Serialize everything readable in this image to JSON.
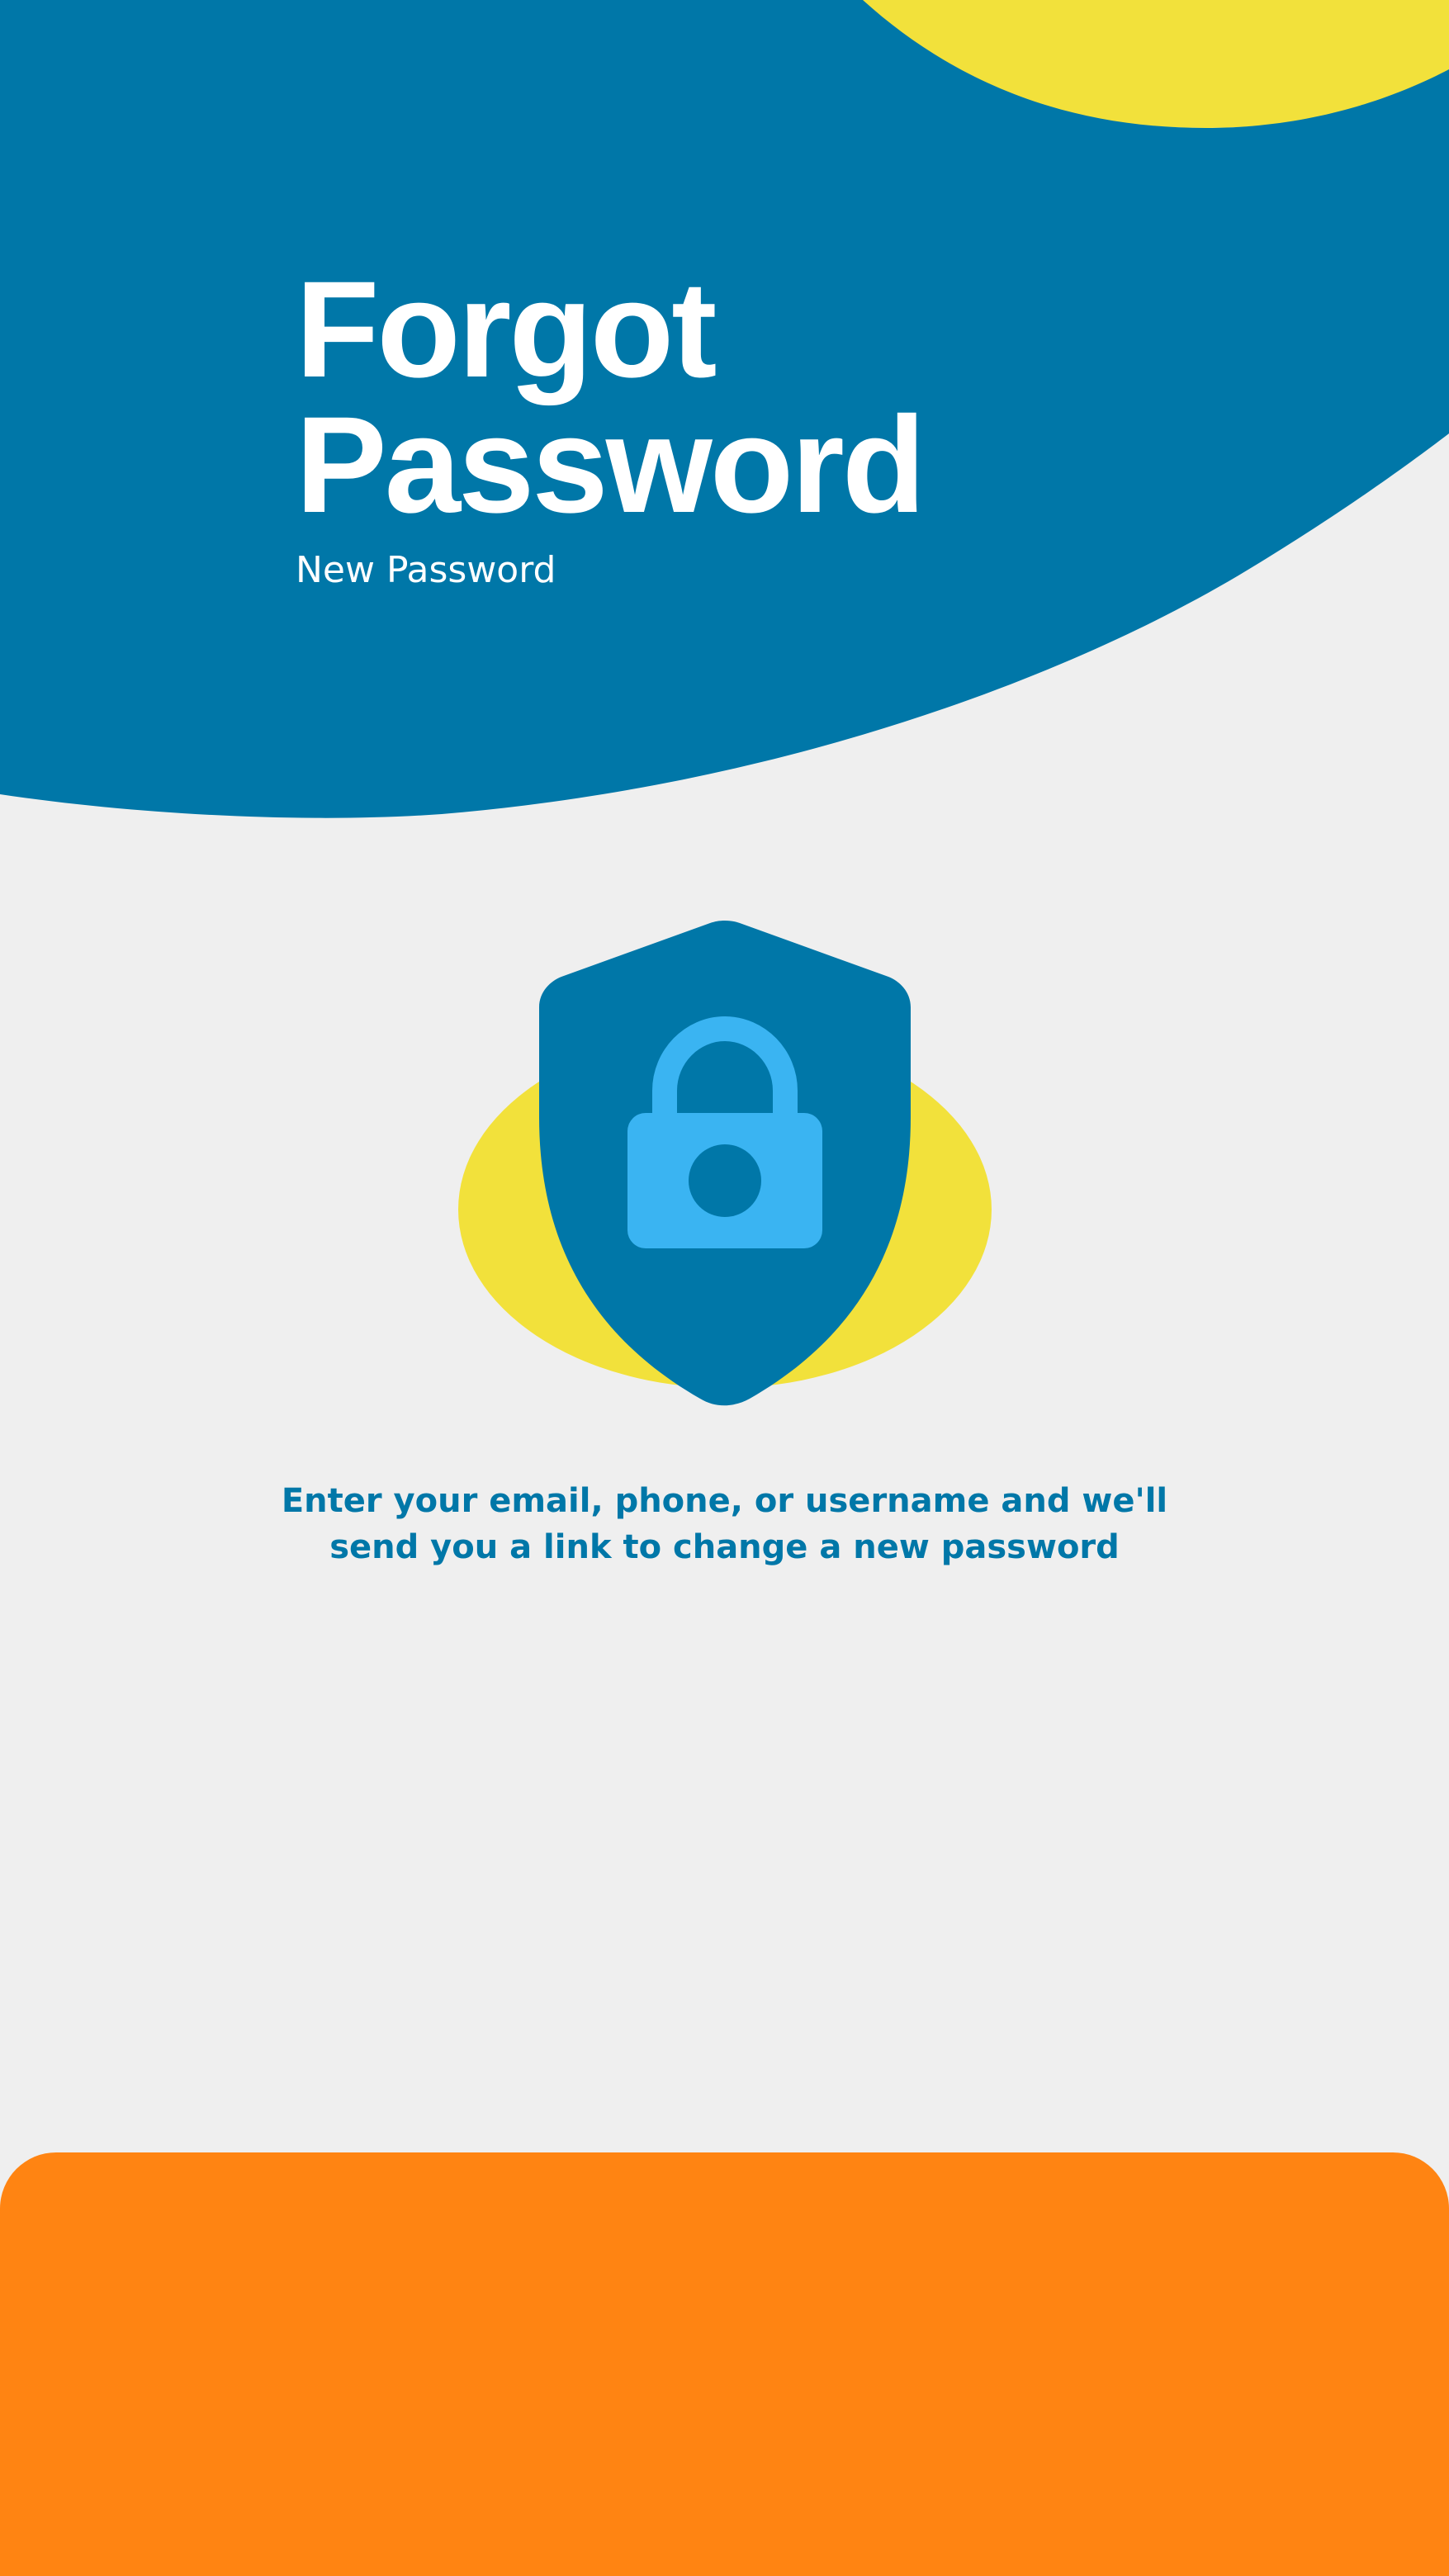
{
  "header": {
    "title_line1": "Forgot",
    "title_line2": "Password",
    "subtitle": "New Password"
  },
  "illustration": {
    "icon": "shield-lock-icon"
  },
  "instruction": {
    "line1": "Enter your email, phone, or username and we'll",
    "line2": "send you a link to change a new password"
  },
  "colors": {
    "background": "#efefef",
    "primary_blue": "#0077a8",
    "accent_yellow": "#f2e13b",
    "lock_blue": "#3ab4f2",
    "orange": "#ff8412",
    "white": "#ffffff"
  }
}
